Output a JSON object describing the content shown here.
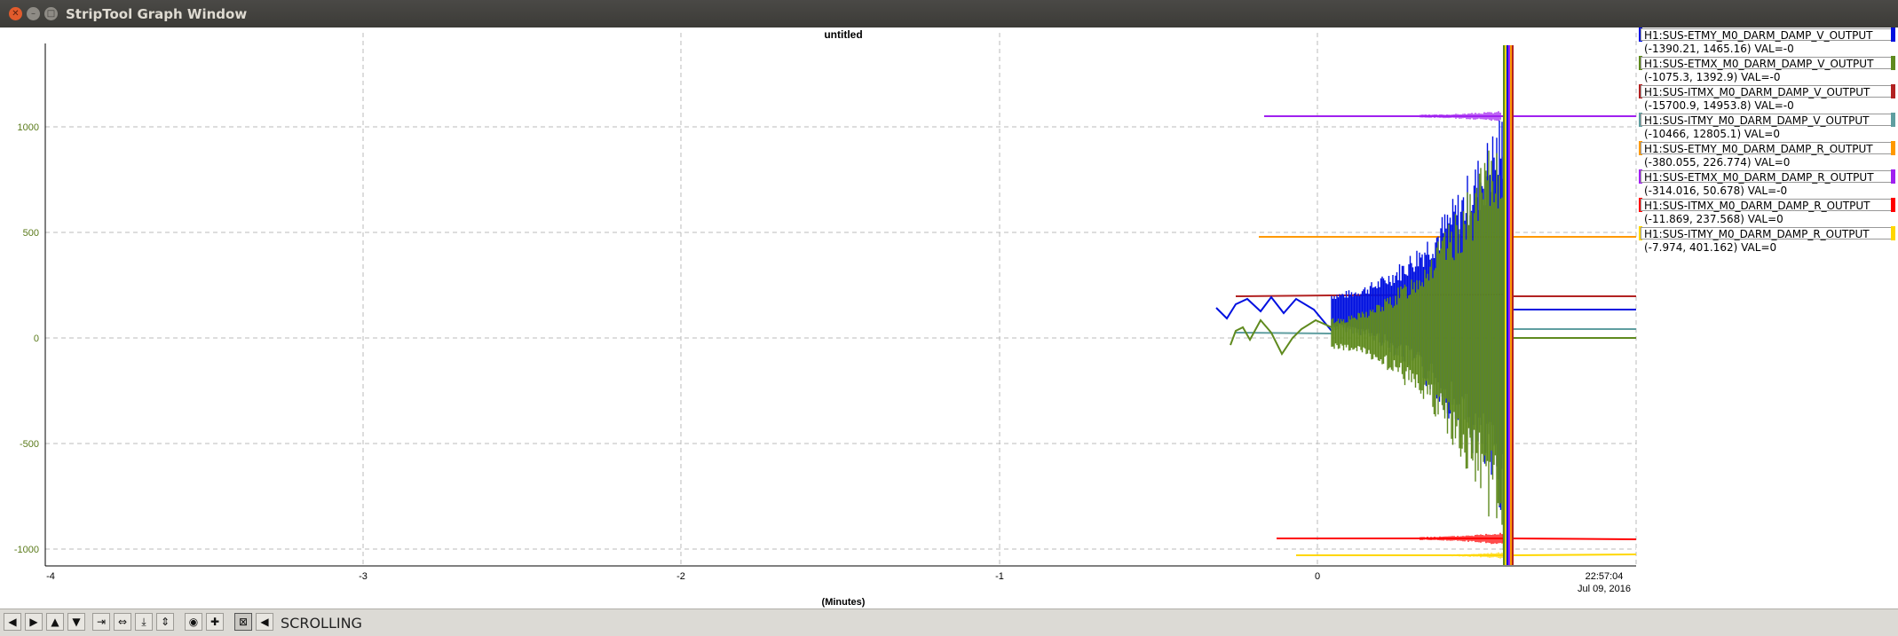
{
  "window": {
    "title": "StripTool Graph Window"
  },
  "graph": {
    "title": "untitled",
    "x_axis_label": "(Minutes)",
    "x_ticks": [
      "-4",
      "-3",
      "-2",
      "-1",
      "0"
    ],
    "y_ticks": [
      "1000",
      "500",
      "0",
      "-500",
      "-1000"
    ],
    "end_time": "22:57:04",
    "end_date": "Jul 09, 2016"
  },
  "legend": [
    {
      "name": "H1:SUS-ETMY_M0_DARM_DAMP_V_OUTPUT",
      "range": "(-1390.21, 1465.16) VAL=-0",
      "color": "#0010e0"
    },
    {
      "name": "H1:SUS-ETMX_M0_DARM_DAMP_V_OUTPUT",
      "range": "(-1075.3, 1392.9) VAL=-0",
      "color": "#5f8a1e"
    },
    {
      "name": "H1:SUS-ITMX_M0_DARM_DAMP_V_OUTPUT",
      "range": "(-15700.9, 14953.8) VAL=-0",
      "color": "#b22222"
    },
    {
      "name": "H1:SUS-ITMY_M0_DARM_DAMP_V_OUTPUT",
      "range": "(-10466, 12805.1) VAL=0",
      "color": "#5f9ea0"
    },
    {
      "name": "H1:SUS-ETMY_M0_DARM_DAMP_R_OUTPUT",
      "range": "(-380.055, 226.774) VAL=0",
      "color": "#ff9900"
    },
    {
      "name": "H1:SUS-ETMX_M0_DARM_DAMP_R_OUTPUT",
      "range": "(-314.016, 50.678) VAL=-0",
      "color": "#a020f0"
    },
    {
      "name": "H1:SUS-ITMX_M0_DARM_DAMP_R_OUTPUT",
      "range": "(-11.869, 237.568) VAL=0",
      "color": "#ff0000"
    },
    {
      "name": "H1:SUS-ITMY_M0_DARM_DAMP_R_OUTPUT",
      "range": "(-7.974, 401.162) VAL=0",
      "color": "#ffd700"
    }
  ],
  "toolbar": {
    "mode": "SCROLLING"
  }
}
